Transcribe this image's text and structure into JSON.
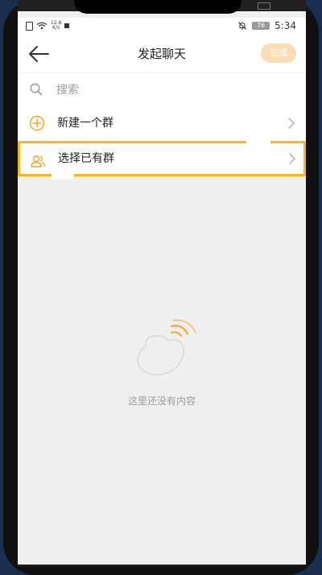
{
  "status_bar": {
    "net_speed_value": "12.8",
    "net_speed_unit": "K/s",
    "battery": "76",
    "time": "5:34"
  },
  "header": {
    "title": "发起聊天",
    "done_label": "完成"
  },
  "search": {
    "placeholder": "搜索"
  },
  "menu": {
    "items": [
      {
        "label": "新建一个群",
        "icon": "add-circle-icon"
      },
      {
        "label": "选择已有群",
        "icon": "group-icon"
      }
    ]
  },
  "empty_state": {
    "text": "这里还没有内容"
  },
  "colors": {
    "accent": "#f5a623",
    "highlight_border": "#f5b820",
    "done_button_bg": "#fbd8a8",
    "background": "#efefef"
  }
}
